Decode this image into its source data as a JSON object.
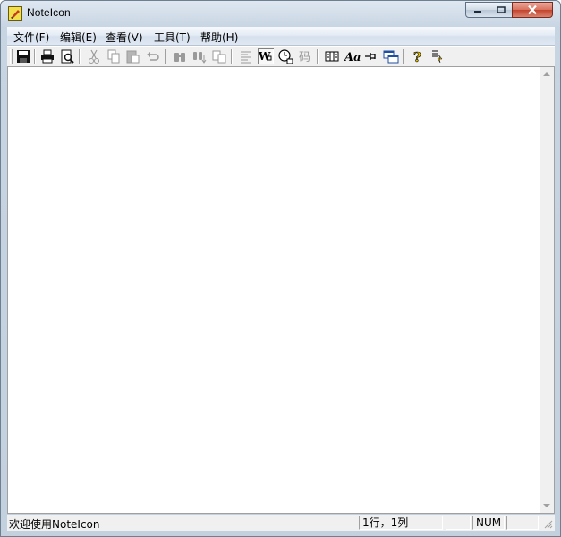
{
  "window": {
    "title": "NoteIcon"
  },
  "menu": [
    {
      "label": "文件(F)"
    },
    {
      "label": "编辑(E)"
    },
    {
      "label": "查看(V)"
    },
    {
      "label": "工具(T)"
    },
    {
      "label": "帮助(H)"
    }
  ],
  "toolbar": {
    "font_button_text": "Aa",
    "code_button_text": "码"
  },
  "statusbar": {
    "message": "欢迎使用NoteIcon",
    "position": "1行，1列",
    "num": "NUM"
  },
  "colors": {
    "title_bg": "#c7d4e2",
    "close_button": "#c4432b",
    "editor_bg": "#ffffff"
  }
}
